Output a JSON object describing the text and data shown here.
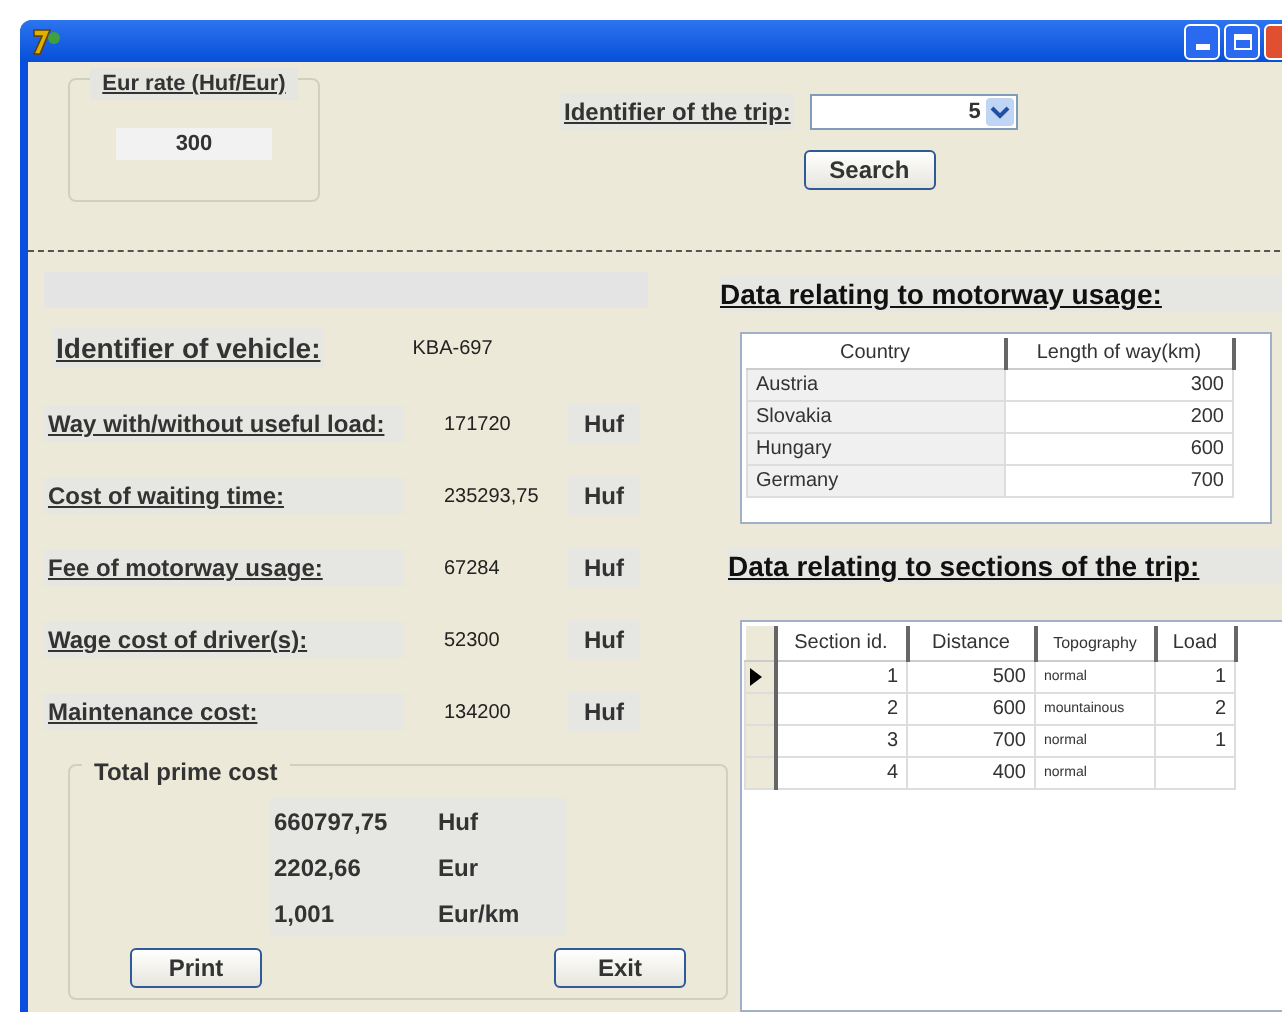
{
  "eur_rate": {
    "label": "Eur rate (Huf/Eur)",
    "value": "300"
  },
  "trip": {
    "label": "Identifier of the trip:",
    "value": "5"
  },
  "search_button": "Search",
  "vehicle": {
    "label": "Identifier of vehicle:",
    "value": "KBA-697"
  },
  "costs": [
    {
      "label": "Way with/without useful load:",
      "value": "171720",
      "unit": "Huf"
    },
    {
      "label": "Cost of waiting time:",
      "value": "235293,75",
      "unit": "Huf"
    },
    {
      "label": "Fee of motorway usage:",
      "value": "67284",
      "unit": "Huf"
    },
    {
      "label": "Wage cost of driver(s):",
      "value": "52300",
      "unit": "Huf"
    },
    {
      "label": "Maintenance cost:",
      "value": "134200",
      "unit": "Huf"
    }
  ],
  "total": {
    "title": "Total prime cost",
    "rows": [
      {
        "value": "660797,75",
        "unit": "Huf"
      },
      {
        "value": "2202,66",
        "unit": "Eur"
      },
      {
        "value": "1,001",
        "unit": "Eur/km"
      }
    ]
  },
  "buttons": [
    "Print",
    "Exit"
  ],
  "motorway": {
    "title": "Data relating to motorway usage:",
    "columns": [
      "Country",
      "Length of way(km)"
    ],
    "rows": [
      [
        "Austria",
        "300"
      ],
      [
        "Slovakia",
        "200"
      ],
      [
        "Hungary",
        "600"
      ],
      [
        "Germany",
        "700"
      ]
    ]
  },
  "sections": {
    "title": "Data relating to sections of the trip:",
    "columns": [
      "Section id.",
      "Distance",
      "Topography",
      "Load"
    ],
    "rows": [
      {
        "selected": true,
        "cells": [
          "1",
          "500",
          "normal",
          "1"
        ]
      },
      {
        "selected": false,
        "cells": [
          "2",
          "600",
          "mountainous",
          "2"
        ]
      },
      {
        "selected": false,
        "cells": [
          "3",
          "700",
          "normal",
          "1"
        ]
      },
      {
        "selected": false,
        "cells": [
          "4",
          "400",
          "normal",
          ""
        ]
      }
    ]
  }
}
